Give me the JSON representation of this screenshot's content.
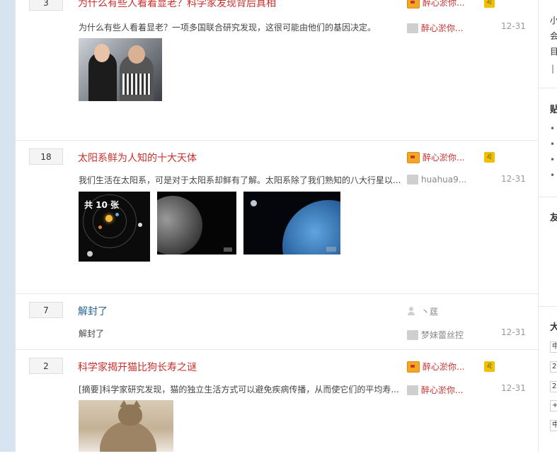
{
  "threads": [
    {
      "count": "3",
      "title": "为什么有些人看着显老？科学家发现背后真相",
      "desc": "为什么有些人看着显老？一项多国联合研究发现，这很可能由他们的基因决定。",
      "author": "醉心淤你...",
      "level_icon": "♌",
      "last_reply": "醉心淤你...",
      "date": "12-31"
    },
    {
      "count": "18",
      "title": "太阳系鲜为人知的十大天体",
      "desc": "我们生活在太阳系，可是对于太阳系却鲜有了解。太阳系除了我们熟知的八大行星以...",
      "author": "醉心淤你...",
      "level_icon": "♌",
      "last_reply": "huahua9...",
      "date": "12-31",
      "image_count": "共 10 张"
    },
    {
      "count": "7",
      "title": "解封了",
      "desc": "解封了",
      "author": "丶莛",
      "last_reply": "梦妹蕾丝控",
      "date": "12-31"
    },
    {
      "count": "2",
      "title": "科学家揭开猫比狗长寿之谜",
      "desc": "[摘要]科学家研究发现，猫的独立生活方式可以避免疾病传播，从而使它们的平均寿...",
      "author": "醉心淤你...",
      "level_icon": "♌",
      "last_reply": "醉心淤你...",
      "date": "12-31"
    }
  ],
  "sidebar": {
    "line1": "小",
    "line2": "会",
    "line3": "目",
    "divider": "|",
    "section1_head": "贴",
    "bullets": [
      "•",
      "•",
      "•",
      "•"
    ],
    "section2_head": "友",
    "section3_head": "大",
    "inputs": [
      "中",
      "2",
      "2",
      "+",
      "中"
    ],
    "top_mark": "'"
  },
  "colors": {
    "accent_red": "#c9302c",
    "link_blue": "#2a6496",
    "left_strip": "#d6e4f2"
  }
}
